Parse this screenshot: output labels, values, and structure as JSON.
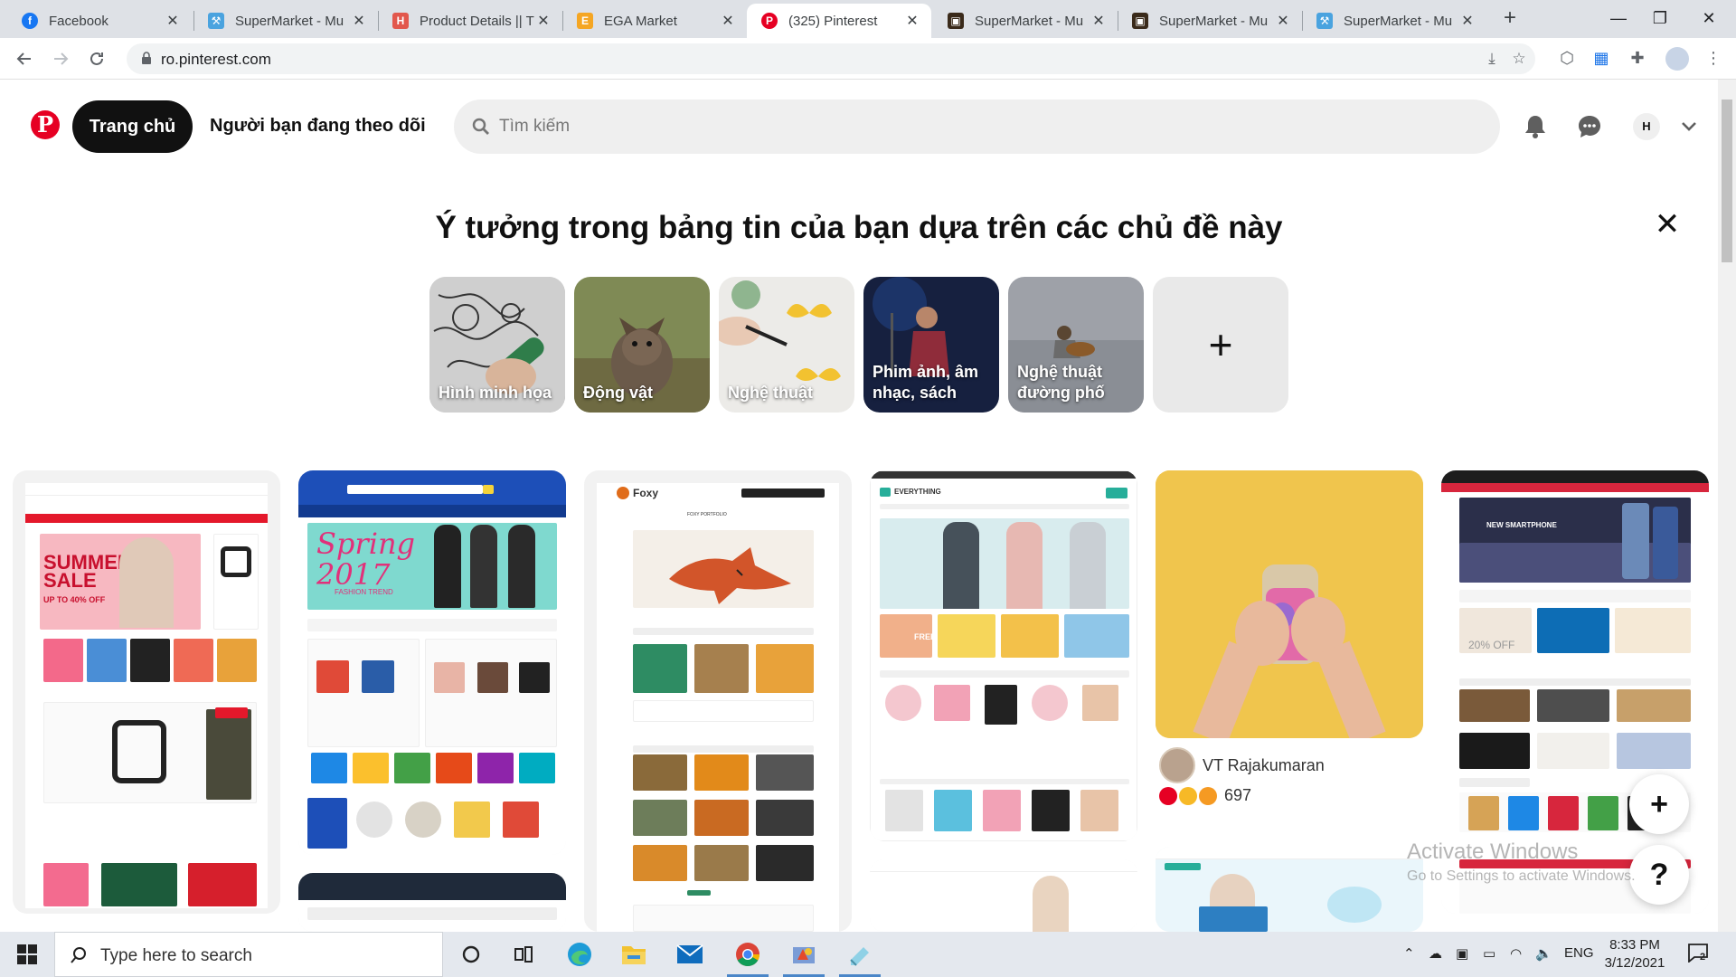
{
  "browser": {
    "tabs": [
      {
        "title": "Facebook",
        "favicon": "facebook-icon",
        "color": "#1877f2",
        "active": false
      },
      {
        "title": "SuperMarket - Mu",
        "favicon": "hammer-icon",
        "color": "#4aa3df",
        "active": false
      },
      {
        "title": "Product Details || T",
        "favicon": "h-logo-icon",
        "color": "#e2574c",
        "active": false
      },
      {
        "title": "EGA Market",
        "favicon": "ega-icon",
        "color": "#f5a623",
        "active": false
      },
      {
        "title": "(325) Pinterest",
        "favicon": "pinterest-icon",
        "color": "#e60023",
        "active": true
      },
      {
        "title": "SuperMarket - Mu",
        "favicon": "theme-icon",
        "color": "#3a2a1a",
        "active": false
      },
      {
        "title": "SuperMarket - Mu",
        "favicon": "theme-icon",
        "color": "#3a2a1a",
        "active": false
      },
      {
        "title": "SuperMarket - Mu",
        "favicon": "hammer-icon",
        "color": "#4aa3df",
        "active": false
      }
    ],
    "close_glyph": "✕",
    "url": "ro.pinterest.com"
  },
  "pinterest": {
    "logo": "P",
    "home_label": "Trang chủ",
    "following_label": "Người bạn đang theo dõi",
    "search_placeholder": "Tìm kiếm",
    "avatar_initial": "H",
    "accent": "#e60023",
    "topics": {
      "title": "Ý tưởng trong bảng tin của bạn dựa trên các chủ đề này",
      "close": "✕",
      "items": [
        {
          "label": "Hình minh họa"
        },
        {
          "label": "Động vật"
        },
        {
          "label": "Nghệ thuật"
        },
        {
          "label": "Phim ảnh, âm nhạc, sách"
        },
        {
          "label": "Nghệ thuật đường phố"
        }
      ],
      "add": "+"
    },
    "pins": [
      {
        "caption": "SUMMER SALE",
        "subcaption": "UP TO 40% OFF"
      },
      {
        "caption": "Spring 2017",
        "subcaption": "FASHION TREND"
      },
      {
        "caption": "Foxy",
        "subcaption": "FOXY PORTFOLIO"
      },
      {
        "caption": "EVERYTHING",
        "subcaption": "FREE"
      },
      {
        "caption": "",
        "subcaption": ""
      },
      {
        "caption": "NEW SMARTPHONE",
        "subcaption": "20% OFF"
      }
    ],
    "featured_pin": {
      "author": "VT Rajakumaran",
      "reactions": "697"
    },
    "floating": {
      "add": "+",
      "help": "?"
    }
  },
  "watermark": {
    "line1": "Activate Windows",
    "line2": "Go to Settings to activate Windows."
  },
  "taskbar": {
    "search_placeholder": "Type here to search",
    "language": "ENG",
    "time": "8:33 PM",
    "date": "3/12/2021",
    "notification_count": "2"
  }
}
